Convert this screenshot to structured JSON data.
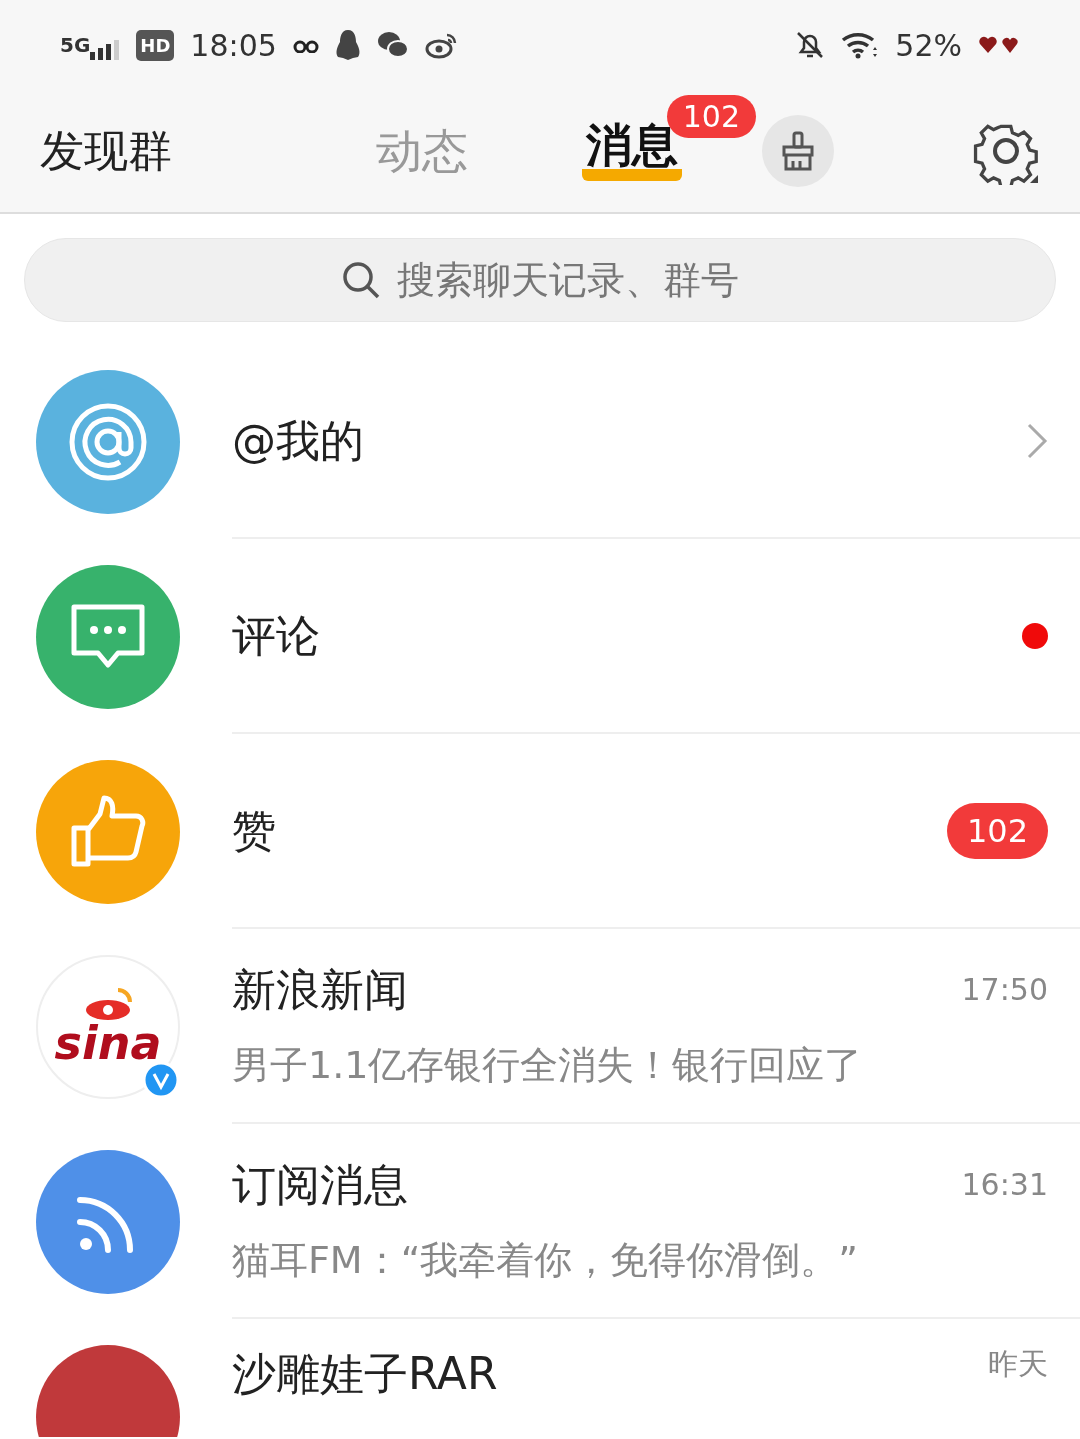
{
  "status_bar": {
    "network": "5G",
    "hd": "HD",
    "time": "18:05",
    "battery": "52%"
  },
  "header": {
    "title": "发现群",
    "tabs": [
      {
        "label": "动态",
        "selected": false
      },
      {
        "label": "消息",
        "selected": true,
        "badge": "102"
      }
    ]
  },
  "search": {
    "placeholder": "搜索聊天记录、群号"
  },
  "rows": [
    {
      "kind": "at",
      "name": "@我的",
      "chevron": true
    },
    {
      "kind": "comment",
      "name": "评论",
      "unread": true,
      "color": "#f00a0a"
    },
    {
      "kind": "like",
      "name": "赞",
      "badge": "102"
    },
    {
      "kind": "sina",
      "name": "新浪新闻",
      "logo_text": "sina",
      "verified": true,
      "preview": "男子1.1亿存银行全消失！银行回应了",
      "time": "17:50"
    },
    {
      "kind": "rss",
      "name": "订阅消息",
      "preview": "猫耳FM：“我牵着你，免得你滑倒。”",
      "time": "16:31"
    },
    {
      "kind": "photo",
      "name": "沙雕娃子RAR",
      "time": "昨天"
    }
  ]
}
